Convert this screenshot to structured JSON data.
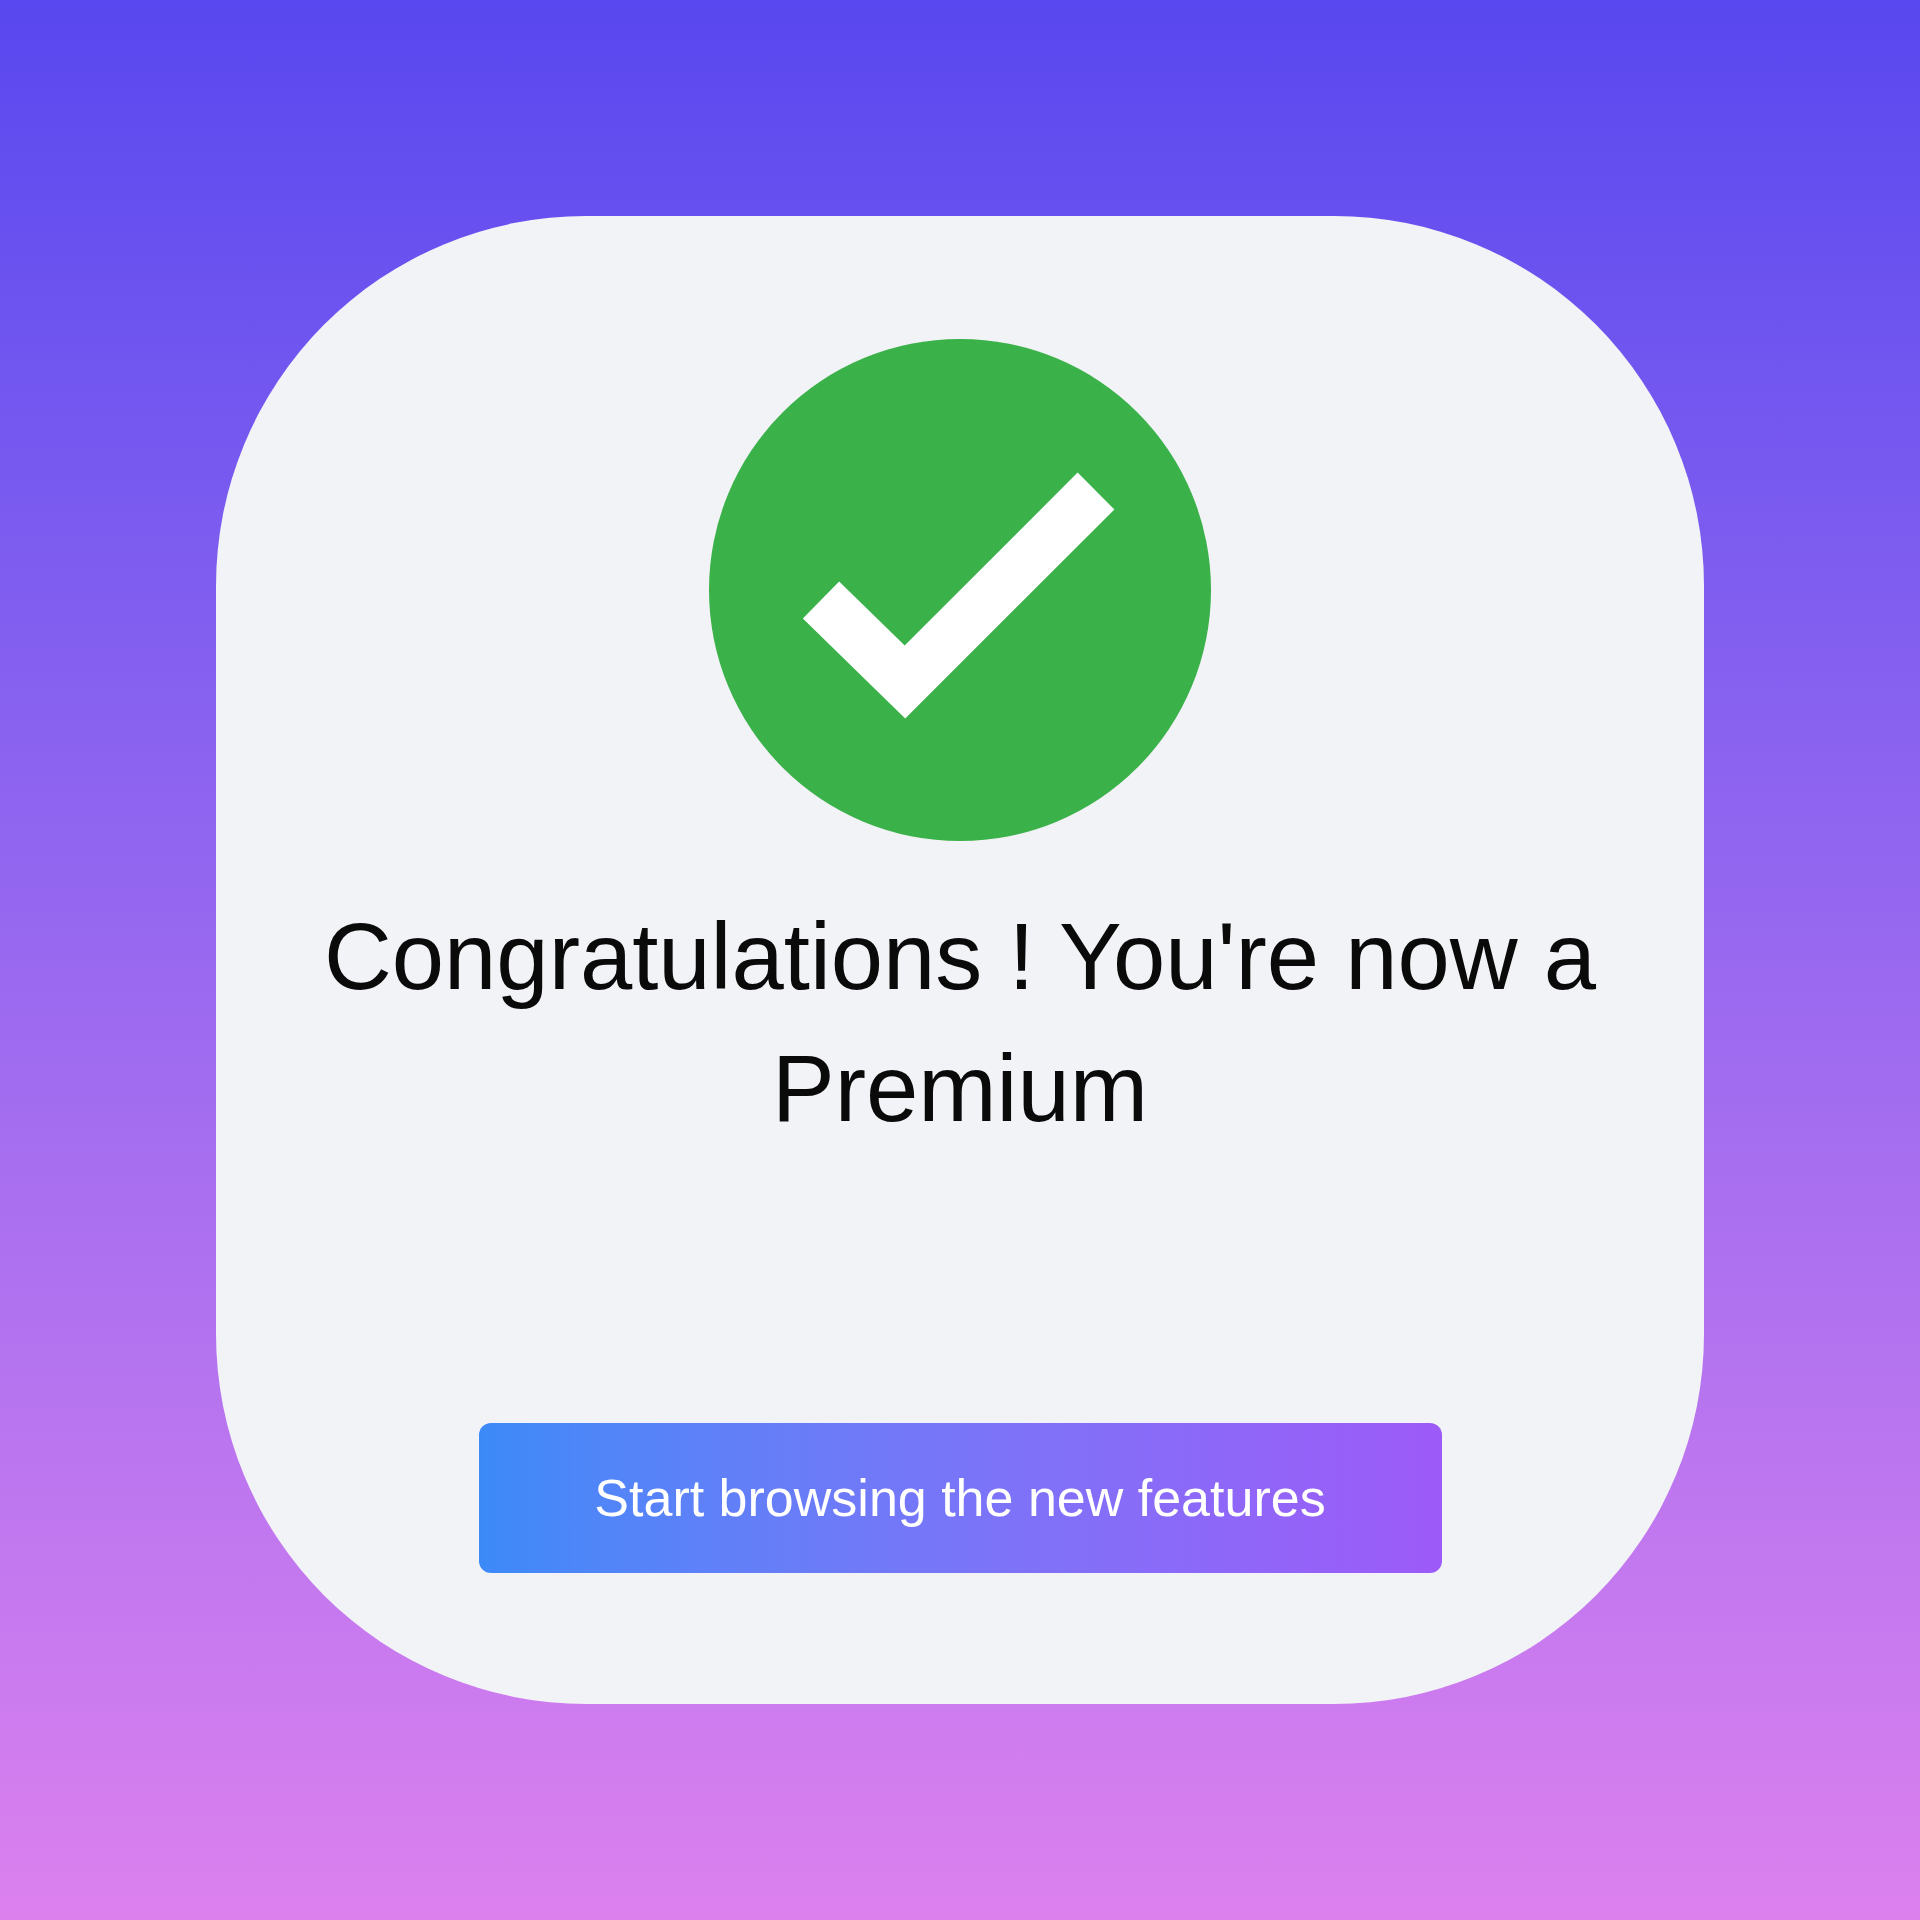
{
  "dialog": {
    "title": "Congratulations ! You're now a Premium",
    "button": "Start browsing the new features"
  }
}
